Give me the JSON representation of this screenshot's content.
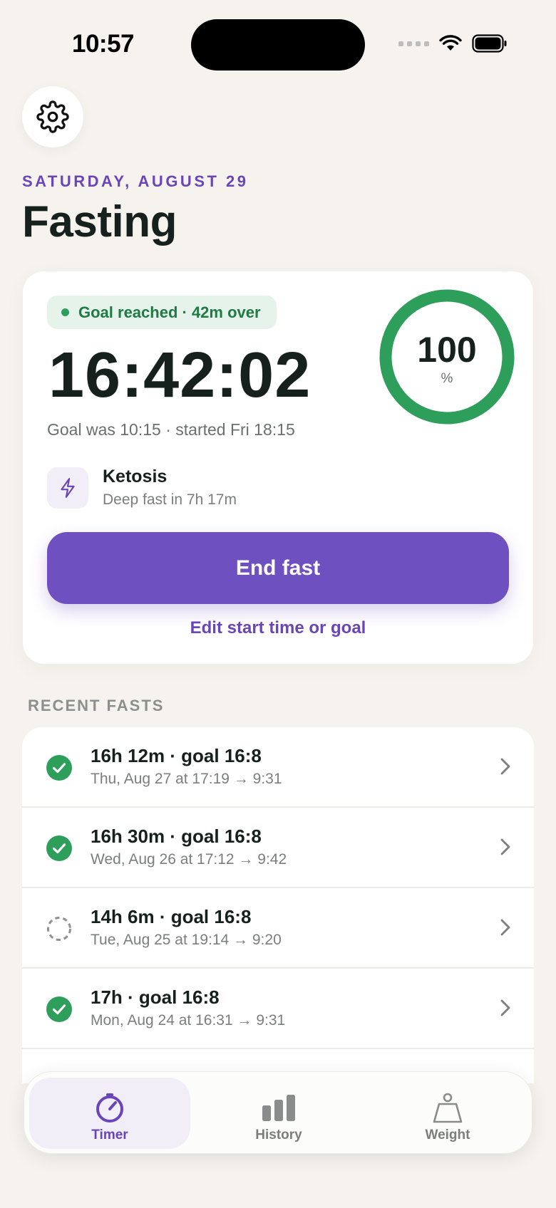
{
  "status_bar": {
    "time": "10:57"
  },
  "header": {
    "date": "SATURDAY, AUGUST 29",
    "title": "Fasting"
  },
  "current_fast": {
    "badge": "Goal reached · 42m over",
    "elapsed": "16:42:02",
    "progress_value": "100",
    "progress_unit": "%",
    "progress_fraction": 1.0,
    "goal_info": "Goal was 10:15 · started Fri 18:15",
    "phase_title": "Ketosis",
    "phase_subtitle": "Deep fast in 7h 17m",
    "end_button": "End fast",
    "edit_link": "Edit start time or goal"
  },
  "recent": {
    "label": "RECENT FASTS",
    "items": [
      {
        "title": "16h 12m · goal 16:8",
        "subtitle": "Thu, Aug 27 at 17:19 → 9:31",
        "status": "completed"
      },
      {
        "title": "16h 30m · goal 16:8",
        "subtitle": "Wed, Aug 26 at 17:12 → 9:42",
        "status": "completed"
      },
      {
        "title": "14h 6m · goal 16:8",
        "subtitle": "Tue, Aug 25 at 19:14 → 9:20",
        "status": "incomplete"
      },
      {
        "title": "17h · goal 16:8",
        "subtitle": "Mon, Aug 24 at 16:31 → 9:31",
        "status": "completed"
      }
    ]
  },
  "tabs": [
    {
      "label": "Timer",
      "icon": "timer-icon",
      "active": true
    },
    {
      "label": "History",
      "icon": "bar-chart-icon",
      "active": false
    },
    {
      "label": "Weight",
      "icon": "scale-weight-icon",
      "active": false
    }
  ],
  "colors": {
    "accent": "#6e50c0",
    "success": "#2e9e5b",
    "background": "#f6f3ee"
  }
}
